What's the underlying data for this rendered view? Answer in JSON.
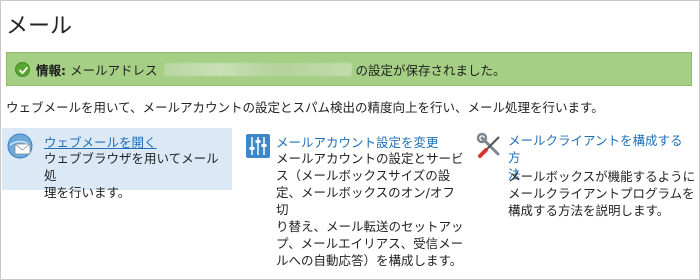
{
  "page": {
    "title": "メール"
  },
  "notice": {
    "label": "情報:",
    "text_before": "メールアドレス",
    "text_after": "の設定が保存されました。"
  },
  "intro": "ウェブメールを用いて、メールアカウントの設定とスパム検出の精度向上を行い、メール処理を行います。",
  "cards": [
    {
      "icon": "webmail-envelope-icon",
      "title": "ウェブメールを開く",
      "desc_lines": [
        "ウェブブラウザを用いてメール処",
        "理を行います。"
      ]
    },
    {
      "icon": "settings-sliders-icon",
      "title": "メールアカウント設定を変更",
      "desc_lines": [
        "メールアカウントの設定とサービ",
        "ス（メールボックスサイズの設",
        "定、メールボックスのオン/オフ切",
        "り替え、メール転送のセットアッ",
        "プ、メールエイリアス、受信メー",
        "ルへの自動応答）を構成します。"
      ]
    },
    {
      "icon": "tools-wrench-screwdriver-icon",
      "title_lines": [
        "メールクライアントを構成する方",
        "法"
      ],
      "desc_lines": [
        "メールボックスが機能するように",
        "メールクライアントプログラムを",
        "構成する方法を説明します。"
      ]
    }
  ],
  "colors": {
    "notice_bg": "#a6cf86",
    "link": "#1f6fb8",
    "active_card_bg": "#dbe9f7",
    "success_icon": "#5aa632"
  }
}
